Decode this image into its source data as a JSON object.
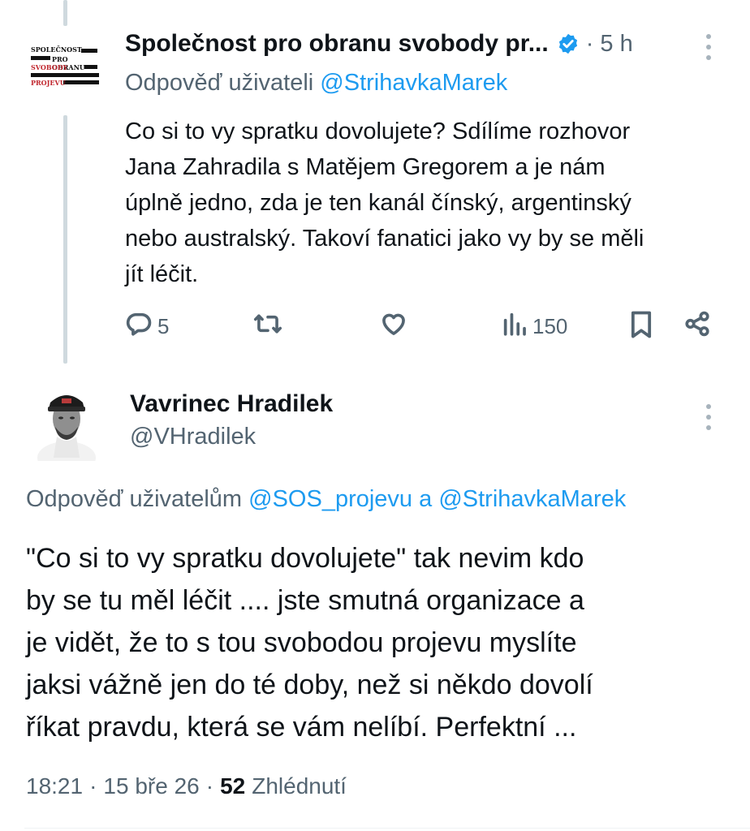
{
  "tweet1": {
    "author_name": "Společnost pro obranu svobody pr...",
    "time": "· 5 h",
    "reply_prefix": "Odpověď uživateli",
    "reply_handle": "@StrihavkaMarek",
    "body_lines": [
      "Co si to vy spratku dovolujete? Sdílíme rozhovor",
      "Jana Zahradila s Matějem Gregorem a je nám",
      "úplně jedno, zda je ten kanál čínský, argentinský",
      "nebo australský. Takoví fanatici jako vy by se měli",
      "jít léčit."
    ],
    "logo_lines": [
      "SPOLEČNOST",
      "PRO OBRANU",
      "SVOBODY",
      "PROJEVU"
    ],
    "actions": {
      "replies": "5",
      "views": "150"
    },
    "icons": [
      "verified-icon",
      "more-icon",
      "reply-icon",
      "retweet-icon",
      "like-icon",
      "views-icon",
      "bookmark-icon",
      "share-icon"
    ]
  },
  "tweet2": {
    "author_name": "Vavrinec Hradilek",
    "handle": "@VHradilek",
    "reply_prefix": "Odpověď uživatelům",
    "reply_handle_1": "@SOS_projevu",
    "reply_and": "a",
    "reply_handle_2": "@StrihavkaMarek",
    "body_lines": [
      "\"Co si to vy spratku dovolujete\" tak nevim kdo",
      "by se tu měl léčit .... jste smutná organizace a",
      "je vidět, že to s tou svobodou projevu myslíte",
      "jaksi vážně jen do té doby, než si někdo dovolí",
      "říkat pravdu, která se vám nelíbí. Perfektní ..."
    ],
    "time": "18:21",
    "date": "15 bře 26",
    "sep": "·",
    "views_count": "52",
    "views_label": "Zhlédnutí"
  },
  "colors": {
    "accent": "#1d9bf0",
    "muted": "#536471",
    "text": "#0f1419",
    "thread_line": "#cfd9de"
  }
}
